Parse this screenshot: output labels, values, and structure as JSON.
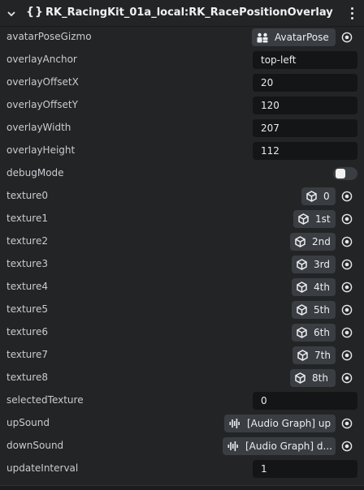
{
  "header": {
    "braces": "{}",
    "title": "RK_RacingKit_01a_local:RK_RacePositionOverlay",
    "collapse_icon": "chevron-down-icon",
    "menu_icon": "kebab-menu-icon"
  },
  "properties": {
    "avatarPoseGizmo": {
      "label": "avatarPoseGizmo",
      "value": "AvatarPose",
      "icon": "avatar-pose-icon"
    },
    "overlayAnchor": {
      "label": "overlayAnchor",
      "value": "top-left"
    },
    "overlayOffsetX": {
      "label": "overlayOffsetX",
      "value": "20"
    },
    "overlayOffsetY": {
      "label": "overlayOffsetY",
      "value": "120"
    },
    "overlayWidth": {
      "label": "overlayWidth",
      "value": "207"
    },
    "overlayHeight": {
      "label": "overlayHeight",
      "value": "112"
    },
    "debugMode": {
      "label": "debugMode",
      "enabled": false
    },
    "textures": [
      {
        "label": "texture0",
        "value": "0"
      },
      {
        "label": "texture1",
        "value": "1st"
      },
      {
        "label": "texture2",
        "value": "2nd"
      },
      {
        "label": "texture3",
        "value": "3rd"
      },
      {
        "label": "texture4",
        "value": "4th"
      },
      {
        "label": "texture5",
        "value": "5th"
      },
      {
        "label": "texture6",
        "value": "6th"
      },
      {
        "label": "texture7",
        "value": "7th"
      },
      {
        "label": "texture8",
        "value": "8th"
      }
    ],
    "selectedTexture": {
      "label": "selectedTexture",
      "value": "0"
    },
    "upSound": {
      "label": "upSound",
      "value": "[Audio Graph] up",
      "icon": "audio-graph-icon"
    },
    "downSound": {
      "label": "downSound",
      "value": "[Audio Graph] d...",
      "icon": "audio-graph-icon"
    },
    "updateInterval": {
      "label": "updateInterval",
      "value": "1"
    }
  },
  "colors": {
    "background": "#222426",
    "field_bg": "#141517",
    "pill_bg": "#3a3d42",
    "text": "#d4d6d9"
  }
}
